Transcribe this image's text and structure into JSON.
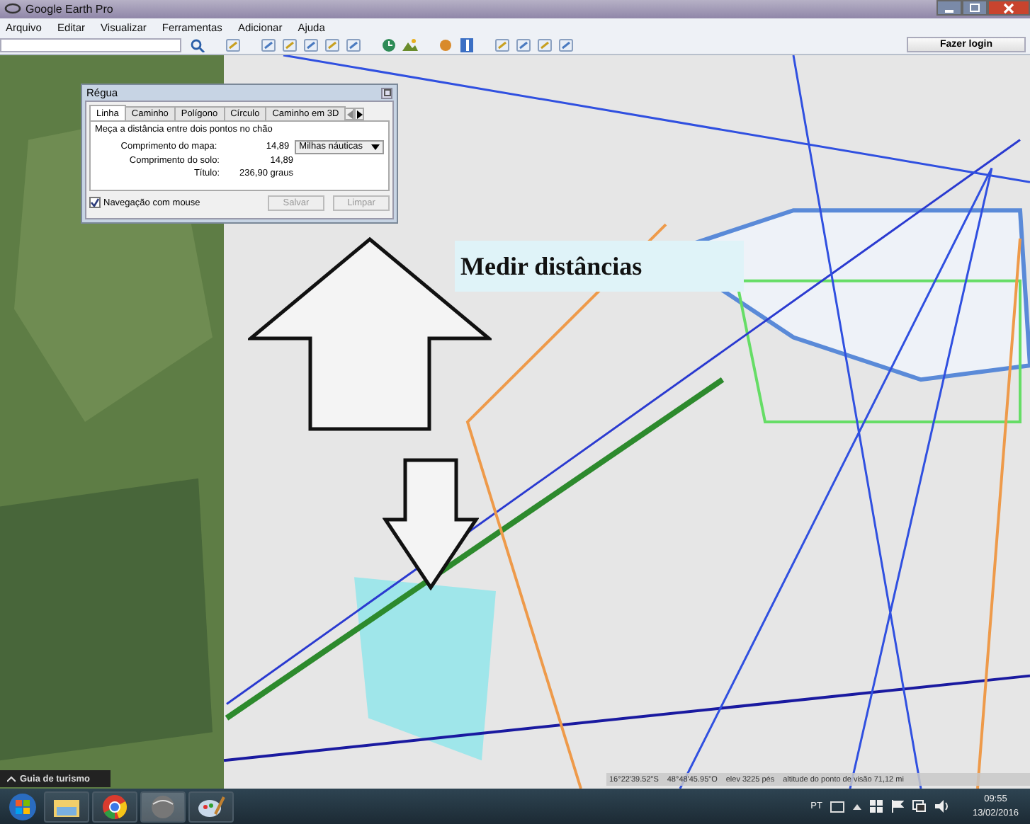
{
  "window": {
    "title": "Google Earth Pro"
  },
  "menu": [
    "Arquivo",
    "Editar",
    "Visualizar",
    "Ferramentas",
    "Adicionar",
    "Ajuda"
  ],
  "toolbar": {
    "login_button": "Fazer login"
  },
  "map": {
    "kind": "picture"
  },
  "annotation": {
    "label": "Medir distâncias"
  },
  "ruler_dialog": {
    "title": "Régua",
    "tabs": [
      {
        "label": "Linha",
        "selected": true
      },
      {
        "label": "Caminho",
        "selected": false
      },
      {
        "label": "Polígono",
        "selected": false
      },
      {
        "label": "Círculo",
        "selected": false
      },
      {
        "label": "Caminho em 3D",
        "selected": false
      }
    ],
    "description": "Meça a distância entre dois pontos no chão",
    "rows": [
      {
        "label": "Comprimento do mapa:",
        "value": "14,89",
        "unit": "Milhas náuticas"
      },
      {
        "label": "Comprimento do solo:",
        "value": "14,89"
      },
      {
        "label": "Título:",
        "value": "236,90 graus"
      }
    ],
    "mouse_navigation": {
      "label": "Navegação com mouse",
      "checked": true
    },
    "buttons": [
      {
        "label": "Salvar",
        "disabled": true
      },
      {
        "label": "Limpar",
        "disabled": true
      }
    ]
  },
  "tour_guide": {
    "label": "Guia de turismo"
  },
  "status_bar": [
    "16°22'39.52\"S",
    "48°48'45.95\"O",
    "elev 3225 pés",
    "altitude do ponto de visão 71,12 mi"
  ],
  "taskbar": {
    "language": "PT",
    "time": "09:55",
    "date": "13/02/2016"
  }
}
